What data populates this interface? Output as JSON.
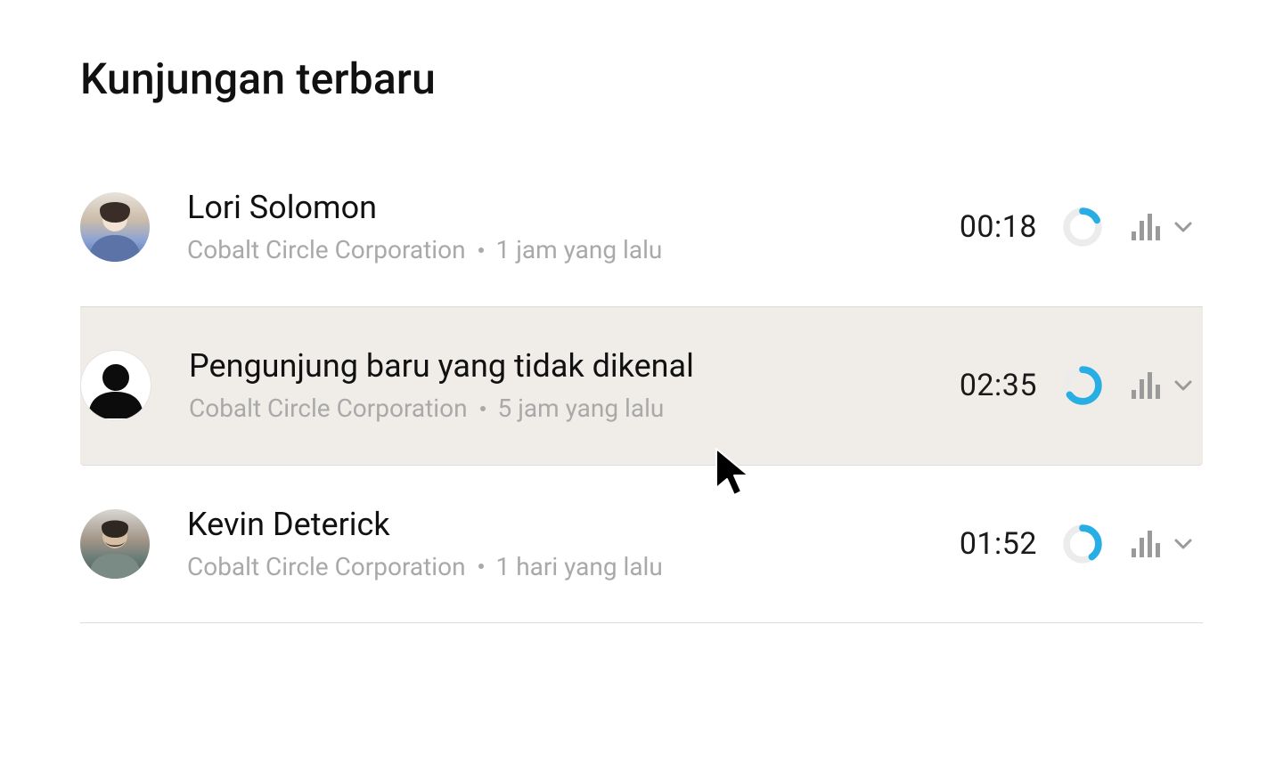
{
  "header": {
    "title": "Kunjungan terbaru"
  },
  "subtitle_separator": "•",
  "accent": "#27aee4",
  "visits": [
    {
      "name": "Lori Solomon",
      "company": "Cobalt Circle Corporation",
      "ago": "1 jam yang lalu",
      "time": "00:18",
      "progress_pct": 18,
      "avatar": "photo-1",
      "hovered": false
    },
    {
      "name": "Pengunjung baru yang tidak dikenal",
      "company": "Cobalt Circle Corporation",
      "ago": "5 jam yang lalu",
      "time": "02:35",
      "progress_pct": 65,
      "avatar": "anon",
      "hovered": true
    },
    {
      "name": "Kevin Deterick",
      "company": "Cobalt Circle Corporation",
      "ago": "1 hari yang lalu",
      "time": "01:52",
      "progress_pct": 40,
      "avatar": "photo-3",
      "hovered": false
    }
  ]
}
